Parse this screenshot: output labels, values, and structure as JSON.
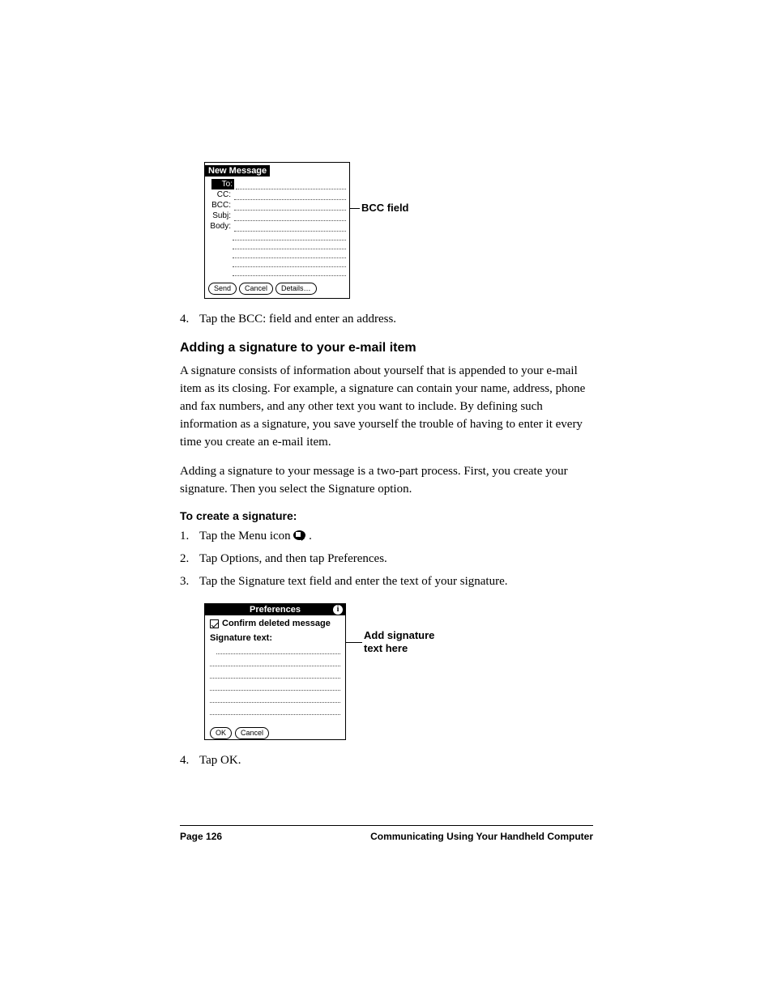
{
  "figure1": {
    "title": "New Message",
    "fields": {
      "to": "To:",
      "cc": "CC:",
      "bcc": "BCC:",
      "subj": "Subj:",
      "body": "Body:"
    },
    "buttons": {
      "send": "Send",
      "cancel": "Cancel",
      "details": "Details…"
    },
    "callout": "BCC field"
  },
  "step_a": {
    "num": "4",
    "text": "Tap the BCC: field and enter an address."
  },
  "heading_sig": "Adding a signature to your e-mail item",
  "para1": "A signature consists of information about yourself that is appended to your e-mail item as its closing. For example, a signature can contain your name, address, phone and fax numbers, and any other text you want to include. By defining such information as a signature, you save yourself the trouble of having to enter it every time you create an e-mail item.",
  "para2": "Adding a signature to your message is a two-part process. First, you create your signature. Then you select the Signature option.",
  "heading_create": "To create a signature:",
  "steps_b": [
    {
      "num": "1",
      "text_pre": "Tap the Menu icon ",
      "text_post": " ."
    },
    {
      "num": "2",
      "text": "Tap Options, and then tap Preferences."
    },
    {
      "num": "3",
      "text": "Tap the Signature text field and enter the text of your signature."
    }
  ],
  "figure2": {
    "title": "Preferences",
    "confirm": "Confirm deleted message",
    "sig_label": "Signature text:",
    "buttons": {
      "ok": "OK",
      "cancel": "Cancel"
    },
    "callout": "Add signature text here"
  },
  "step_c": {
    "num": "4",
    "text": "Tap OK."
  },
  "footer": {
    "page": "Page 126",
    "chapter": "Communicating Using Your Handheld Computer"
  }
}
